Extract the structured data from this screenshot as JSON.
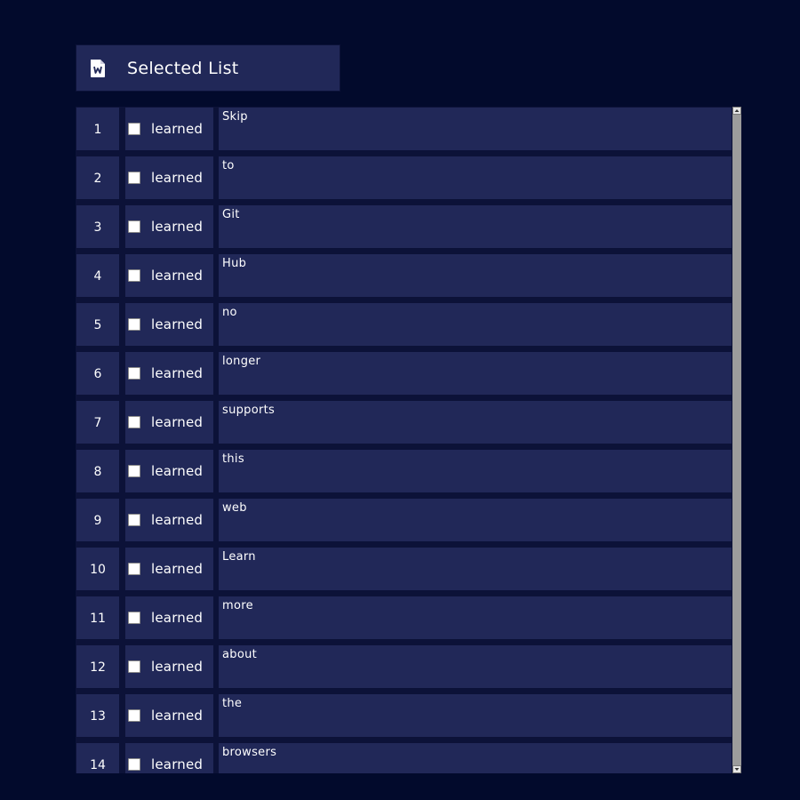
{
  "header": {
    "icon": "word-document-icon",
    "title": "Selected List"
  },
  "list": {
    "checkbox_label": "learned",
    "rows": [
      {
        "num": "1",
        "word": "Skip",
        "learned": false
      },
      {
        "num": "2",
        "word": "to",
        "learned": false
      },
      {
        "num": "3",
        "word": "Git",
        "learned": false
      },
      {
        "num": "4",
        "word": "Hub",
        "learned": false
      },
      {
        "num": "5",
        "word": "no",
        "learned": false
      },
      {
        "num": "6",
        "word": "longer",
        "learned": false
      },
      {
        "num": "7",
        "word": "supports",
        "learned": false
      },
      {
        "num": "8",
        "word": "this",
        "learned": false
      },
      {
        "num": "9",
        "word": "web",
        "learned": false
      },
      {
        "num": "10",
        "word": "Learn",
        "learned": false
      },
      {
        "num": "11",
        "word": "more",
        "learned": false
      },
      {
        "num": "12",
        "word": "about",
        "learned": false
      },
      {
        "num": "13",
        "word": "the",
        "learned": false
      },
      {
        "num": "14",
        "word": "browsers",
        "learned": false
      }
    ]
  },
  "colors": {
    "page_background": "#020a2c",
    "panel_background": "#212858",
    "panel_border": "#0c1238",
    "text": "#ffffff"
  }
}
